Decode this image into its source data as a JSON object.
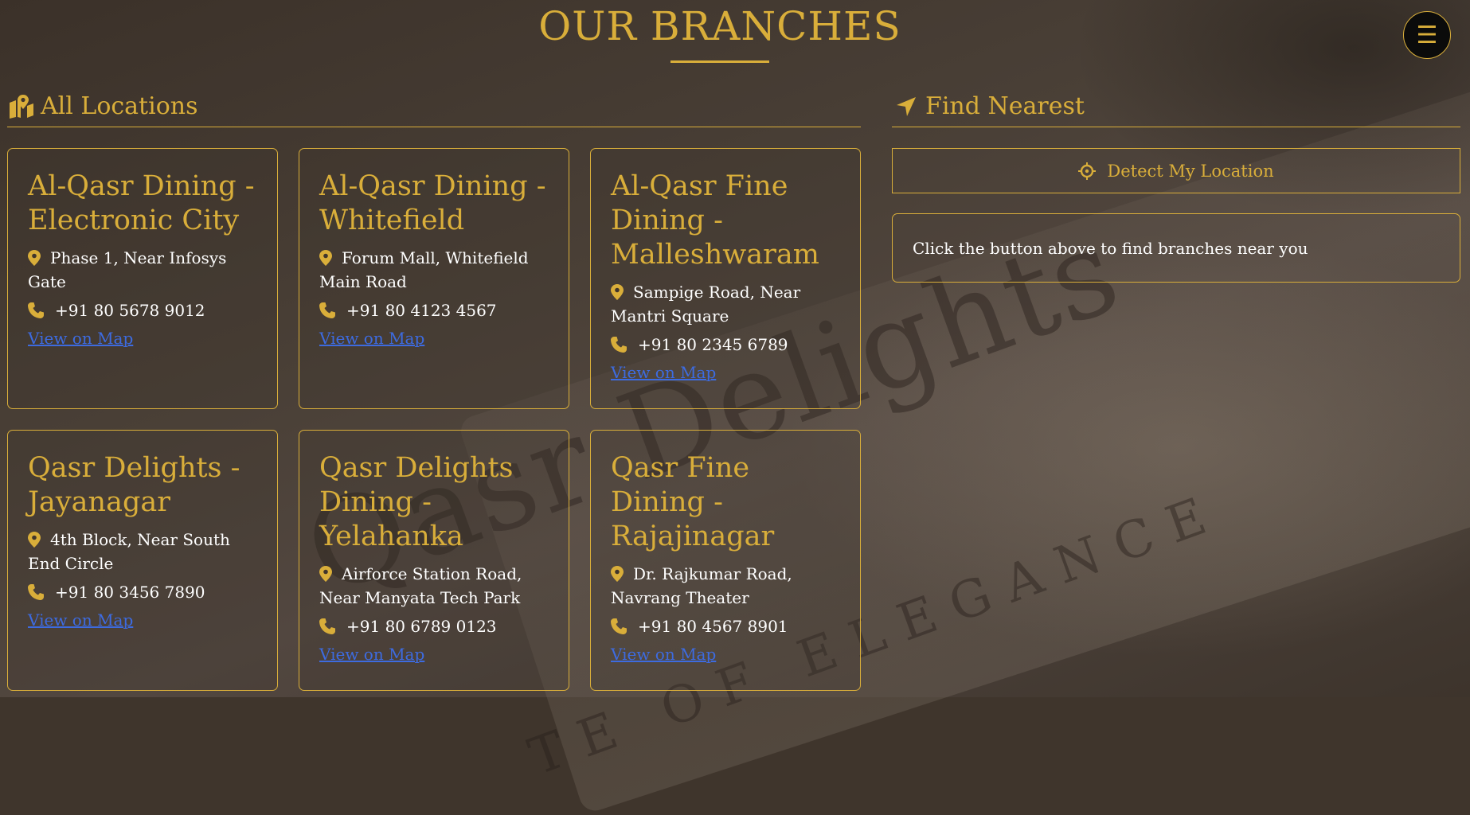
{
  "page": {
    "title": "OUR BRANCHES",
    "menu_icon": "☰"
  },
  "colors": {
    "accent": "#d9ae3a",
    "link": "#3d6be0",
    "text": "#ffffff"
  },
  "all_locations": {
    "heading": "All Locations",
    "icon": "map-location-icon",
    "branches": [
      {
        "name": "Al-Qasr Dining - Electronic City",
        "address": "Phase 1, Near Infosys Gate",
        "phone": "+91 80 5678 9012",
        "link": "View on Map"
      },
      {
        "name": "Al-Qasr Dining - Whitefield",
        "address": "Forum Mall, Whitefield Main Road",
        "phone": "+91 80 4123 4567",
        "link": "View on Map"
      },
      {
        "name": "Al-Qasr Fine Dining - Malleshwaram",
        "address": "Sampige Road, Near Mantri Square",
        "phone": "+91 80 2345 6789",
        "link": "View on Map"
      },
      {
        "name": "Qasr Delights - Jayanagar",
        "address": "4th Block, Near South End Circle",
        "phone": "+91 80 3456 7890",
        "link": "View on Map"
      },
      {
        "name": "Qasr Delights Dining - Yelahanka",
        "address": "Airforce Station Road, Near Manyata Tech Park",
        "phone": "+91 80 6789 0123",
        "link": "View on Map"
      },
      {
        "name": "Qasr Fine Dining - Rajajinagar",
        "address": "Dr. Rajkumar Road, Navrang Theater",
        "phone": "+91 80 4567 8901",
        "link": "View on Map"
      }
    ]
  },
  "find_nearest": {
    "heading": "Find Nearest",
    "icon": "location-arrow-icon",
    "detect_label": "Detect My Location",
    "detect_icon": "crosshairs-icon",
    "info_text": "Click the button above to find branches near you"
  },
  "background": {
    "watermark_brand": "Qasr Delights",
    "watermark_tagline": "TE OF ELEGANCE"
  }
}
